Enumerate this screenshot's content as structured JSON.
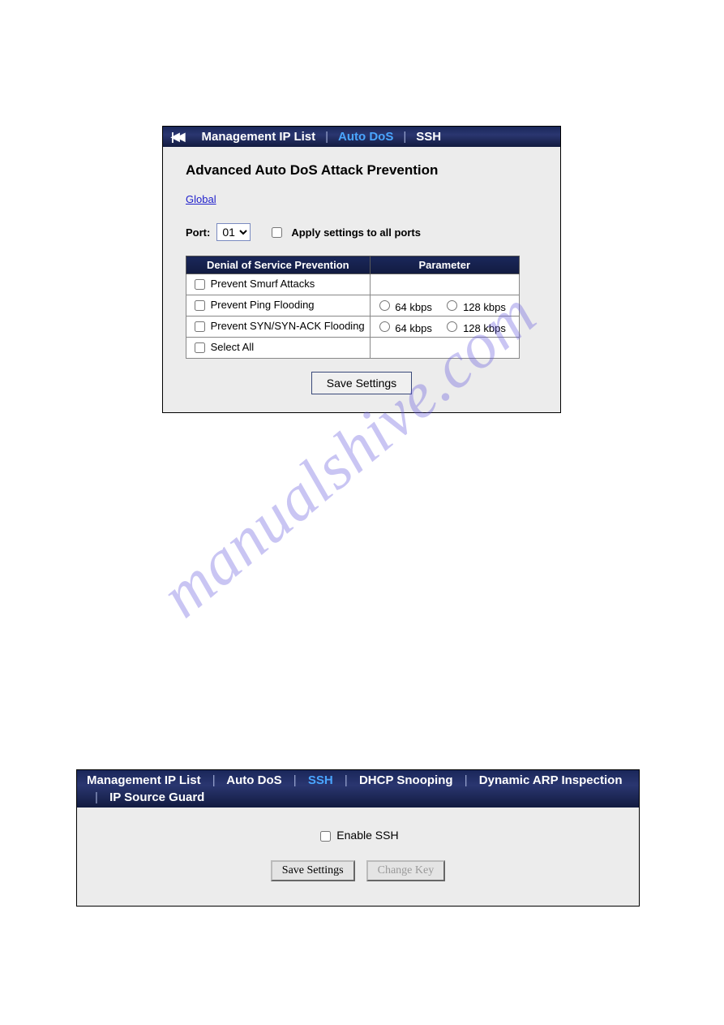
{
  "watermark": "manualshive.com",
  "panel1": {
    "tabs": {
      "management_ip": "Management IP List",
      "auto_dos": "Auto DoS",
      "ssh": "SSH"
    },
    "title": "Advanced Auto DoS Attack Prevention",
    "global_link": "Global",
    "port_label": "Port:",
    "port_value": "01",
    "apply_all_label": "Apply settings to all ports",
    "table": {
      "header_dos": "Denial of Service Prevention",
      "header_param": "Parameter",
      "rows": {
        "smurf": "Prevent Smurf Attacks",
        "ping": "Prevent Ping Flooding",
        "syn": "Prevent SYN/SYN-ACK Flooding",
        "select_all": "Select All"
      },
      "rate_64": "64 kbps",
      "rate_128": "128 kbps"
    },
    "save_button": "Save Settings"
  },
  "panel2": {
    "tabs": {
      "management_ip": "Management IP List",
      "auto_dos": "Auto DoS",
      "ssh": "SSH",
      "dhcp_snooping": "DHCP Snooping",
      "dynamic_arp": "Dynamic ARP Inspection",
      "ip_source_guard": "IP Source Guard"
    },
    "enable_ssh_label": "Enable SSH",
    "save_button": "Save Settings",
    "change_key_button": "Change Key"
  }
}
